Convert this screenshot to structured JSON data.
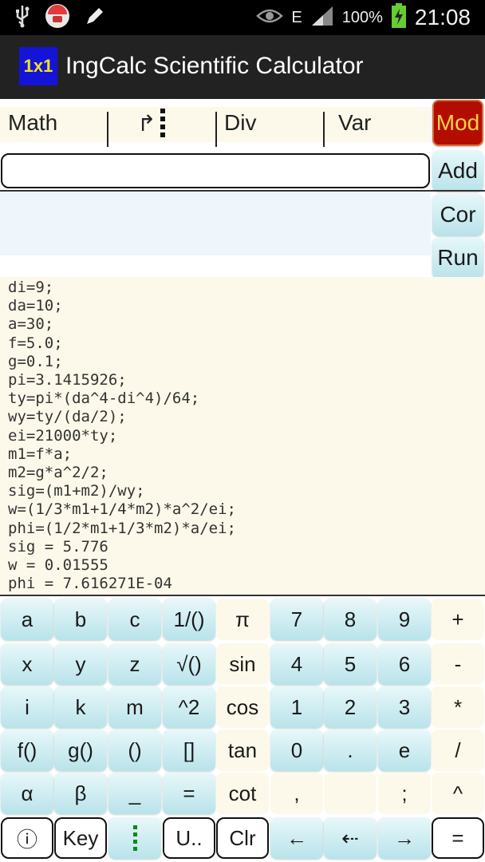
{
  "status": {
    "battery": "100%",
    "time": "21:08",
    "network_letter": "E"
  },
  "app": {
    "logo": "1x1",
    "title": "IngCalc Scientific Calculator"
  },
  "menu": {
    "math": "Math",
    "goto": "↱",
    "div": "Div",
    "var": "Var"
  },
  "side_buttons": {
    "mod": "Mod",
    "add": "Add",
    "cor": "Cor",
    "run": "Run"
  },
  "input": {
    "value": ""
  },
  "output_lines": [
    "di=9;",
    "da=10;",
    "a=30;",
    "f=5.0;",
    "g=0.1;",
    "pi=3.1415926;",
    "ty=pi*(da^4-di^4)/64;",
    "wy=ty/(da/2);",
    "ei=21000*ty;",
    "m1=f*a;",
    "m2=g*a^2/2;",
    "sig=(m1+m2)/wy;",
    "w=(1/3*m1+1/4*m2)*a^2/ei;",
    "phi=(1/2*m1+1/3*m2)*a/ei;",
    "sig = 5.776",
    "w = 0.01555",
    "phi = 7.616271E-04"
  ],
  "keys": [
    [
      {
        "label": "a",
        "style": "blue"
      },
      {
        "label": "b",
        "style": "blue"
      },
      {
        "label": "c",
        "style": "blue"
      },
      {
        "label": "1/()",
        "style": "blue"
      },
      {
        "label": "π",
        "style": "cream"
      },
      {
        "label": "7",
        "style": "blue"
      },
      {
        "label": "8",
        "style": "blue"
      },
      {
        "label": "9",
        "style": "blue"
      },
      {
        "label": "+",
        "style": "cream"
      }
    ],
    [
      {
        "label": "x",
        "style": "blue"
      },
      {
        "label": "y",
        "style": "blue"
      },
      {
        "label": "z",
        "style": "blue"
      },
      {
        "label": "√()",
        "style": "blue"
      },
      {
        "label": "sin",
        "style": "cream"
      },
      {
        "label": "4",
        "style": "blue"
      },
      {
        "label": "5",
        "style": "blue"
      },
      {
        "label": "6",
        "style": "blue"
      },
      {
        "label": "-",
        "style": "cream"
      }
    ],
    [
      {
        "label": "i",
        "style": "blue"
      },
      {
        "label": "k",
        "style": "blue"
      },
      {
        "label": "m",
        "style": "blue"
      },
      {
        "label": "^2",
        "style": "blue"
      },
      {
        "label": "cos",
        "style": "cream"
      },
      {
        "label": "1",
        "style": "blue"
      },
      {
        "label": "2",
        "style": "blue"
      },
      {
        "label": "3",
        "style": "blue"
      },
      {
        "label": "*",
        "style": "cream"
      }
    ],
    [
      {
        "label": "f()",
        "style": "blue"
      },
      {
        "label": "g()",
        "style": "blue"
      },
      {
        "label": "()",
        "style": "blue"
      },
      {
        "label": "[]",
        "style": "blue"
      },
      {
        "label": "tan",
        "style": "cream"
      },
      {
        "label": "0",
        "style": "blue"
      },
      {
        "label": ".",
        "style": "blue"
      },
      {
        "label": "e",
        "style": "blue"
      },
      {
        "label": "/",
        "style": "cream"
      }
    ],
    [
      {
        "label": "α",
        "style": "blue"
      },
      {
        "label": "β",
        "style": "blue"
      },
      {
        "label": "_",
        "style": "blue"
      },
      {
        "label": "=",
        "style": "blue"
      },
      {
        "label": "cot",
        "style": "cream"
      },
      {
        "label": ",",
        "style": "cream"
      },
      {
        "label": "",
        "style": "cream"
      },
      {
        "label": ";",
        "style": "cream"
      },
      {
        "label": "^",
        "style": "cream"
      }
    ],
    [
      {
        "label": "ⓘ",
        "style": "outline"
      },
      {
        "label": "Key",
        "style": "outline"
      },
      {
        "label": "",
        "style": "blue",
        "icon": "green-dots"
      },
      {
        "label": "U..",
        "style": "outline"
      },
      {
        "label": "Clr",
        "style": "outline"
      },
      {
        "label": "←",
        "style": "blue"
      },
      {
        "label": "⇠",
        "style": "blue"
      },
      {
        "label": "→",
        "style": "blue"
      },
      {
        "label": "=",
        "style": "outline"
      }
    ]
  ]
}
